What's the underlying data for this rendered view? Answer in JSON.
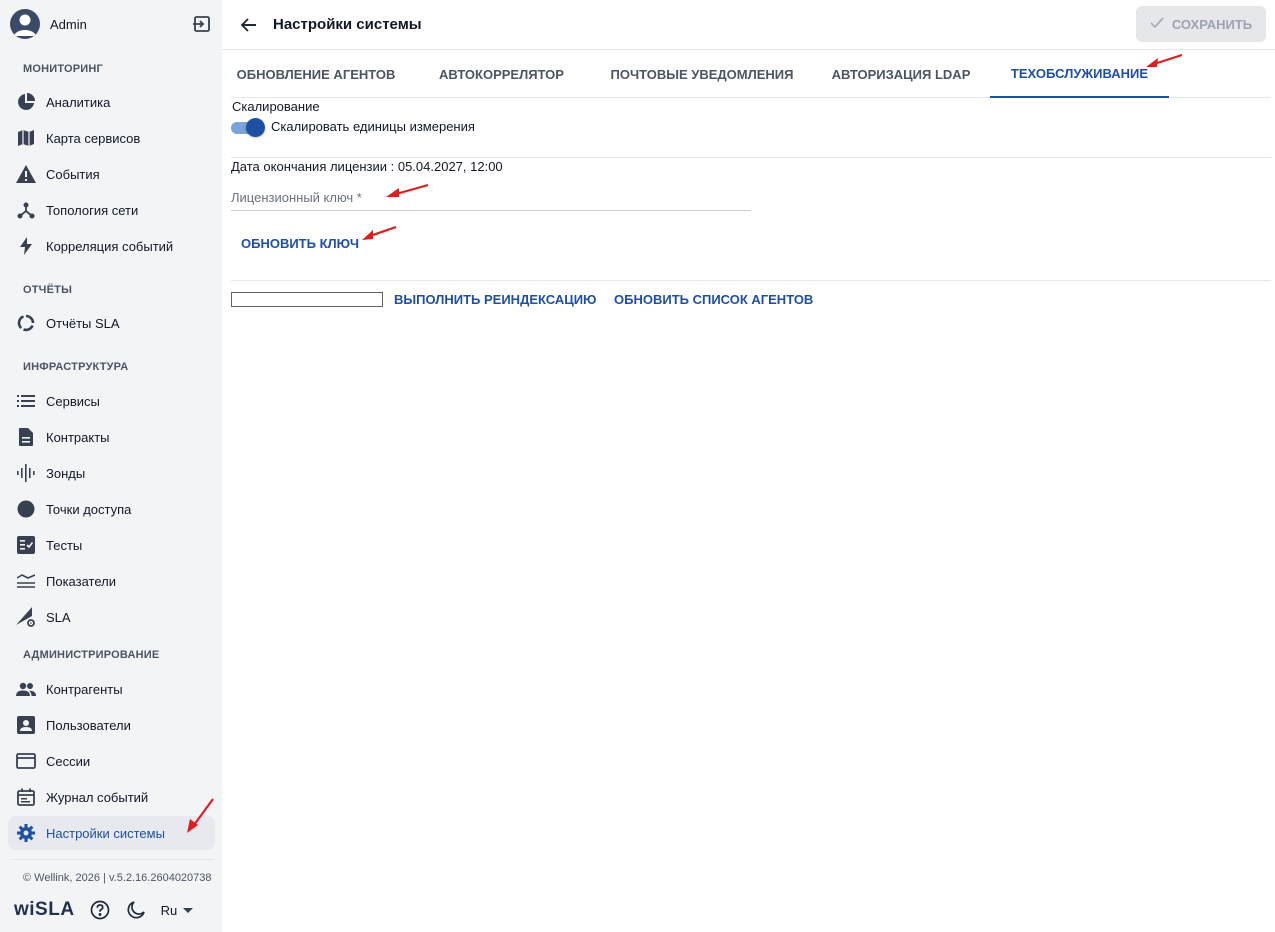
{
  "user": {
    "name": "Admin",
    "avatar_icon": "account-circle-icon",
    "logout_icon": "logout-icon"
  },
  "sidebar": {
    "sections": [
      {
        "title": "МОНИТОРИНГ",
        "items": [
          {
            "label": "Аналитика",
            "icon": "pie-chart-icon"
          },
          {
            "label": "Карта сервисов",
            "icon": "map-icon"
          },
          {
            "label": "События",
            "icon": "warning-icon"
          },
          {
            "label": "Топология сети",
            "icon": "topology-icon"
          },
          {
            "label": "Корреляция событий",
            "icon": "bolt-icon"
          }
        ]
      },
      {
        "title": "ОТЧЁТЫ",
        "items": [
          {
            "label": "Отчёты SLA",
            "icon": "donut-icon"
          }
        ]
      },
      {
        "title": "ИНФРАСТРУКТУРА",
        "items": [
          {
            "label": "Сервисы",
            "icon": "list-icon"
          },
          {
            "label": "Контракты",
            "icon": "document-icon"
          },
          {
            "label": "Зонды",
            "icon": "waveform-icon"
          },
          {
            "label": "Точки доступа",
            "icon": "circle-icon"
          },
          {
            "label": "Тесты",
            "icon": "checklist-icon"
          },
          {
            "label": "Показатели",
            "icon": "stacked-lines-icon"
          },
          {
            "label": "SLA",
            "icon": "signal-gear-icon"
          }
        ]
      },
      {
        "title": "АДМИНИСТРИРОВАНИЕ",
        "items": [
          {
            "label": "Контрагенты",
            "icon": "people-icon"
          },
          {
            "label": "Пользователи",
            "icon": "account-box-icon"
          },
          {
            "label": "Сессии",
            "icon": "window-icon"
          },
          {
            "label": "Журнал событий",
            "icon": "calendar-icon"
          },
          {
            "label": "Настройки системы",
            "icon": "gear-icon",
            "active": true
          }
        ]
      }
    ],
    "copyright": "© Wellink, 2026 | v.5.2.16.2604020738",
    "logo": "wiSLA",
    "help_icon": "help-circle-icon",
    "theme_icon": "moon-icon",
    "language": "Ru"
  },
  "header": {
    "back_icon": "arrow-left-icon",
    "title": "Настройки системы",
    "save_label": "СОХРАНИТЬ",
    "save_icon": "check-icon"
  },
  "tabs": [
    {
      "label": "ОБНОВЛЕНИЕ АГЕНТОВ"
    },
    {
      "label": "АВТОКОРРЕЛЯТОР"
    },
    {
      "label": "ПОЧТОВЫЕ УВЕДОМЛЕНИЯ"
    },
    {
      "label": "АВТОРИЗАЦИЯ LDAP"
    },
    {
      "label": "ТЕХОБСЛУЖИВАНИЕ",
      "active": true
    }
  ],
  "maintenance": {
    "scaling_title": "Скалирование",
    "scaling_toggle_label": "Скалировать единицы измерения",
    "scaling_enabled": true,
    "license_expiry": "Дата окончания лицензии : 05.04.2027, 12:00",
    "license_key_placeholder": "Лицензионный ключ *",
    "license_key_value": "",
    "update_key_label": "ОБНОВИТЬ КЛЮЧ",
    "reindex_progress": 0,
    "reindex_label": "ВЫПОЛНИТЬ РЕИНДЕКСАЦИЮ",
    "update_agents_label": "ОБНОВИТЬ СПИСОК АГЕНТОВ"
  },
  "colors": {
    "accent": "#1e4fa3",
    "sidebar_bg": "#f3f4f6",
    "annotation": "#e11d1d"
  }
}
